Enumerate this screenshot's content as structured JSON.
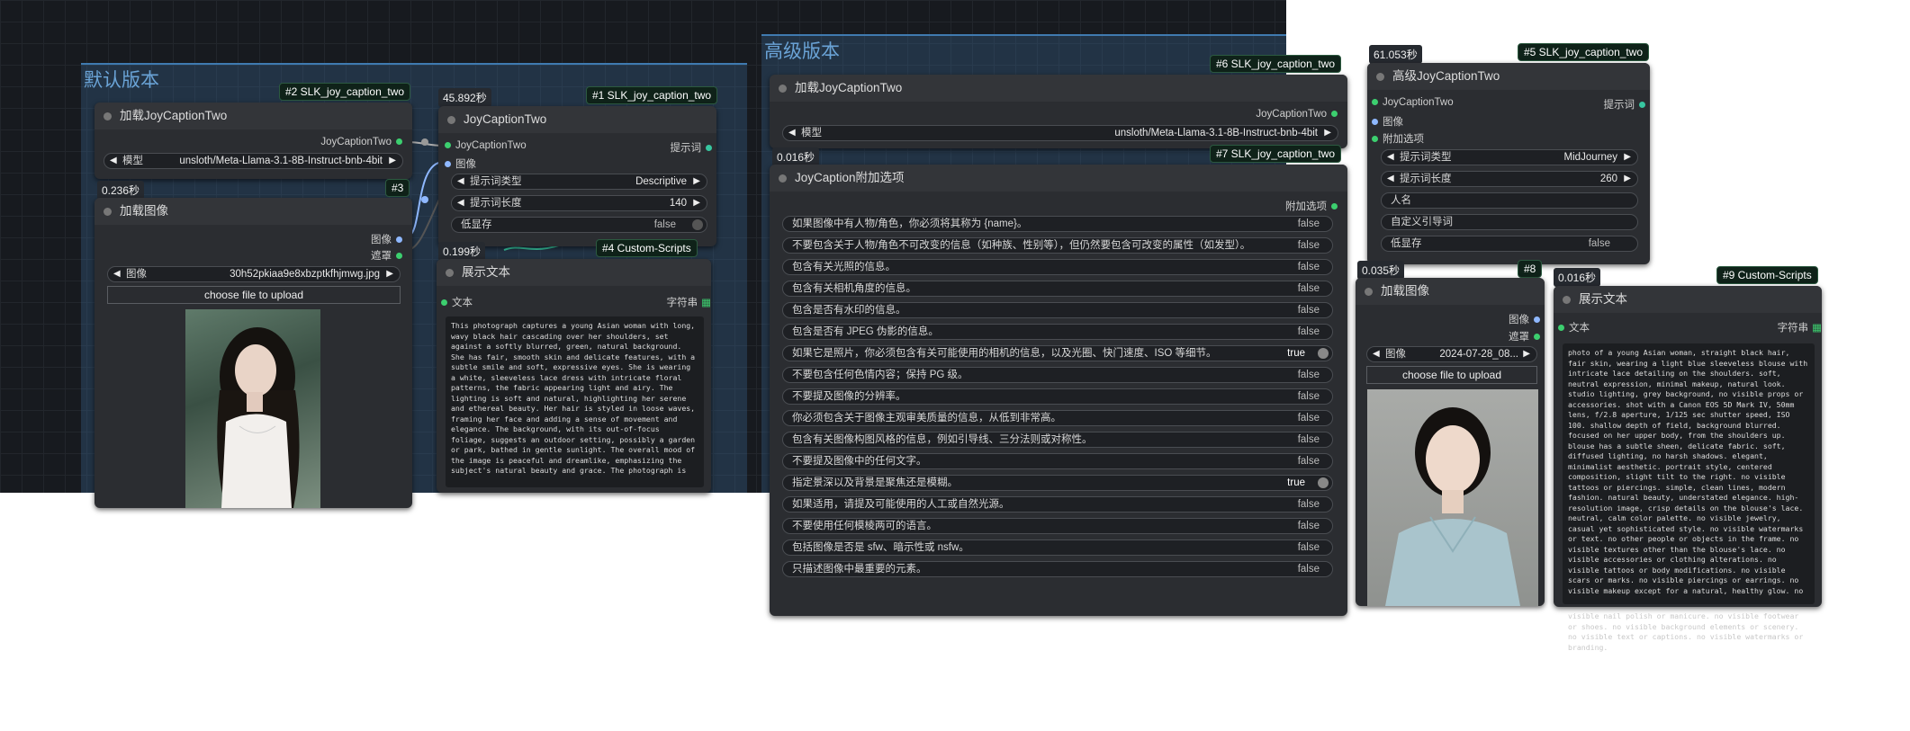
{
  "groups": {
    "default": "默认版本",
    "advanced": "高级版本"
  },
  "node2": {
    "badge": "#2 SLK_joy_caption_two",
    "title": "加载JoyCaptionTwo",
    "output": "JoyCaptionTwo",
    "model_label": "模型",
    "model_value": "unsloth/Meta-Llama-3.1-8B-Instruct-bnb-4bit"
  },
  "node1": {
    "badge": "#1 SLK_joy_caption_two",
    "time": "45.892秒",
    "title": "JoyCaptionTwo",
    "in_clip": "JoyCaptionTwo",
    "in_image": "图像",
    "output": "提示词",
    "type_label": "提示词类型",
    "type_value": "Descriptive",
    "len_label": "提示词长度",
    "len_value": "140",
    "lowvram_label": "低显存",
    "lowvram_value": "false"
  },
  "node3": {
    "badge": "#3",
    "time": "0.236秒",
    "title": "加载图像",
    "out_image": "图像",
    "out_mask": "遮罩",
    "image_label": "图像",
    "image_value": "30h52pkiaa9e8xbzptkfhjmwg.jpg",
    "upload": "choose file to upload"
  },
  "node4": {
    "badge": "#4 Custom-Scripts",
    "time": "0.199秒",
    "title": "展示文本",
    "in_text": "文本",
    "out_str": "字符串",
    "text": "This photograph captures a young Asian woman with long, wavy black hair cascading over her shoulders, set against a softly blurred, green, natural background. She has fair, smooth skin and delicate features, with a subtle smile and soft, expressive eyes. She is wearing a white, sleeveless lace dress with intricate floral patterns, the fabric appearing light and airy. The lighting is soft and natural, highlighting her serene and ethereal beauty. Her hair is styled in loose waves, framing her face and adding a sense of movement and elegance. The background, with its out-of-focus foliage, suggests an outdoor setting, possibly a garden or park, bathed in gentle sunlight. The overall mood of the image is peaceful and dreamlike, emphasizing the subject's natural beauty and grace. The photograph is"
  },
  "node6": {
    "badge": "#6 SLK_joy_caption_two",
    "title": "加载JoyCaptionTwo",
    "output": "JoyCaptionTwo",
    "model_label": "模型",
    "model_value": "unsloth/Meta-Llama-3.1-8B-Instruct-bnb-4bit"
  },
  "node7": {
    "badge": "#7 SLK_joy_caption_two",
    "time": "0.016秒",
    "title": "JoyCaption附加选项",
    "output": "附加选项",
    "options": [
      {
        "label": "如果图像中有人物/角色，你必须将其称为 {name}。",
        "value": "false",
        "on": false
      },
      {
        "label": "不要包含关于人物/角色不可改变的信息（如种族、性别等），但仍然要包含可改变的属性（如发型）。",
        "value": "false",
        "on": false
      },
      {
        "label": "包含有关光照的信息。",
        "value": "false",
        "on": false
      },
      {
        "label": "包含有关相机角度的信息。",
        "value": "false",
        "on": false
      },
      {
        "label": "包含是否有水印的信息。",
        "value": "false",
        "on": false
      },
      {
        "label": "包含是否有 JPEG 伪影的信息。",
        "value": "false",
        "on": false
      },
      {
        "label": "如果它是照片，你必须包含有关可能使用的相机的信息，以及光圈、快门速度、ISO 等细节。",
        "value": "true",
        "on": true
      },
      {
        "label": "不要包含任何色情内容；保持 PG 级。",
        "value": "false",
        "on": false
      },
      {
        "label": "不要提及图像的分辨率。",
        "value": "false",
        "on": false
      },
      {
        "label": "你必须包含关于图像主观审美质量的信息，从低到非常高。",
        "value": "false",
        "on": false
      },
      {
        "label": "包含有关图像构图风格的信息，例如引导线、三分法则或对称性。",
        "value": "false",
        "on": false
      },
      {
        "label": "不要提及图像中的任何文字。",
        "value": "false",
        "on": false
      },
      {
        "label": "指定景深以及背景是聚焦还是模糊。",
        "value": "true",
        "on": true
      },
      {
        "label": "如果适用，请提及可能使用的人工或自然光源。",
        "value": "false",
        "on": false
      },
      {
        "label": "不要使用任何模棱两可的语言。",
        "value": "false",
        "on": false
      },
      {
        "label": "包括图像是否是 sfw、暗示性或 nsfw。",
        "value": "false",
        "on": false
      },
      {
        "label": "只描述图像中最重要的元素。",
        "value": "false",
        "on": false
      }
    ]
  },
  "node5": {
    "badge": "#5 SLK_joy_caption_two",
    "time": "61.053秒",
    "title": "高级JoyCaptionTwo",
    "in_clip": "JoyCaptionTwo",
    "in_image": "图像",
    "in_extra": "附加选项",
    "output": "提示词",
    "type_label": "提示词类型",
    "type_value": "MidJourney",
    "len_label": "提示词长度",
    "len_value": "260",
    "name_label": "人名",
    "guide_label": "自定义引导词",
    "lowvram_label": "低显存",
    "lowvram_value": "false"
  },
  "node8": {
    "badge": "#8",
    "time": "0.035秒",
    "title": "加载图像",
    "out_image": "图像",
    "out_mask": "遮罩",
    "image_label": "图像",
    "image_value": "2024-07-28_08...",
    "upload": "choose file to upload"
  },
  "node9": {
    "badge": "#9 Custom-Scripts",
    "time": "0.016秒",
    "title": "展示文本",
    "in_text": "文本",
    "out_str": "字符串",
    "text": "photo of a young Asian woman, straight black hair, fair skin, wearing a light blue sleeveless blouse with intricate lace detailing on the shoulders. soft, neutral expression, minimal makeup, natural look. studio lighting, grey background, no visible props or accessories. shot with a Canon EOS 5D Mark IV, 50mm lens, f/2.8 aperture, 1/125 sec shutter speed, ISO 100. shallow depth of field, background blurred. focused on her upper body, from the shoulders up. blouse has a subtle sheen, delicate fabric. soft, diffused lighting, no harsh shadows. elegant, minimalist aesthetic. portrait style, centered composition, slight tilt to the right. no visible tattoos or piercings. simple, clean lines, modern fashion. natural beauty, understated elegance. high-resolution image, crisp details on the blouse's lace. neutral, calm color palette. no visible jewelry, casual yet sophisticated style. no visible watermarks or text. no other people or objects in the frame. no visible textures other than the blouse's lace. no visible accessories or clothing alterations. no visible tattoos or body modifications. no visible scars or marks. no visible piercings or earrings. no visible makeup except for a natural, healthy glow. no",
    "overflow_text": "visible nail polish or manicure. no visible footwear or shoes. no visible background elements or scenery. no visible text or captions. no visible watermarks or branding."
  }
}
